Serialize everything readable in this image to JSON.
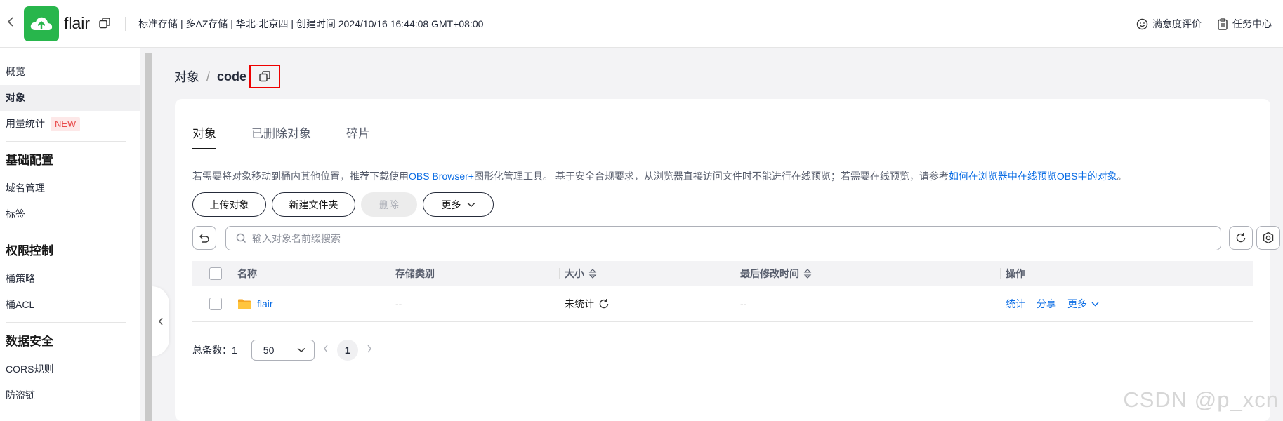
{
  "header": {
    "bucket_name": "flair",
    "meta": "标准存储 | 多AZ存储 | 华北-北京四 | 创建时间  2024/10/16 16:44:08 GMT+08:00",
    "satisfaction": "满意度评价",
    "task_center": "任务中心"
  },
  "sidebar": {
    "items_top": [
      {
        "label": "概览"
      },
      {
        "label": "对象"
      },
      {
        "label": "用量统计",
        "badge": "NEW"
      }
    ],
    "group1": {
      "title": "基础配置",
      "items": [
        {
          "label": "域名管理"
        },
        {
          "label": "标签"
        }
      ]
    },
    "group2": {
      "title": "权限控制",
      "items": [
        {
          "label": "桶策略"
        },
        {
          "label": "桶ACL"
        }
      ]
    },
    "group3": {
      "title": "数据安全",
      "items": [
        {
          "label": "CORS规则"
        },
        {
          "label": "防盗链"
        }
      ]
    }
  },
  "breadcrumb": {
    "root": "对象",
    "sep": "/",
    "current": "code"
  },
  "tabs": [
    {
      "label": "对象"
    },
    {
      "label": "已删除对象"
    },
    {
      "label": "碎片"
    }
  ],
  "notice": {
    "part1": "若需要将对象移动到桶内其他位置，推荐下载使用",
    "link1": "OBS Browser+",
    "part2": "图形化管理工具。 基于安全合规要求，从浏览器直接访问文件时不能进行在线预览；若需要在线预览，请参考",
    "link2": "如何在浏览器中在线预览OBS中的对象",
    "part3": "。"
  },
  "actions": {
    "upload": "上传对象",
    "new_folder": "新建文件夹",
    "delete": "删除",
    "more": "更多"
  },
  "search": {
    "placeholder": "输入对象名前缀搜索"
  },
  "table": {
    "headers": {
      "name": "名称",
      "storage": "存储类别",
      "size": "大小",
      "modified": "最后修改时间",
      "ops": "操作"
    },
    "rows": [
      {
        "name": "flair",
        "storage": "--",
        "size": "未统计",
        "modified": "--",
        "op_stat": "统计",
        "op_share": "分享",
        "op_more": "更多"
      }
    ]
  },
  "pagination": {
    "total_label": "总条数：",
    "total": "1",
    "page_size": "50",
    "current_page": "1"
  },
  "watermark": "CSDN @p_xcn",
  "colors": {
    "brand_green": "#28b64c",
    "link_blue": "#0a6ce4",
    "highlight_red": "#ee0000",
    "folder_yellow": "#f5a623"
  }
}
